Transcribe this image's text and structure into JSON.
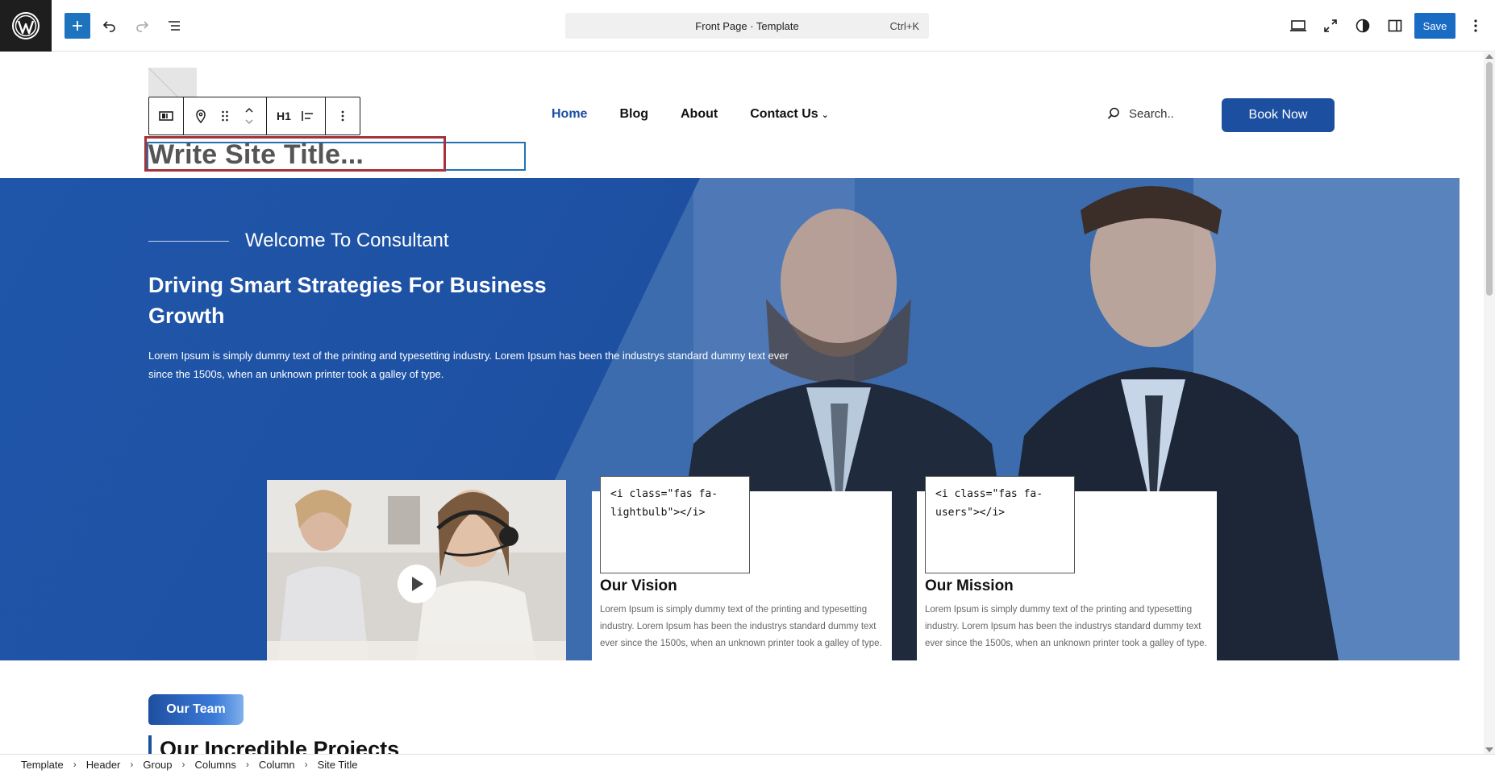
{
  "toolbar": {
    "document_title": "Front Page · Template",
    "shortcut": "Ctrl+K",
    "save_label": "Save"
  },
  "header": {
    "site_title_placeholder": "Write Site Title...",
    "block_toolbar": {
      "heading_level": "H1"
    },
    "nav": [
      {
        "label": "Home",
        "active": true
      },
      {
        "label": "Blog",
        "active": false
      },
      {
        "label": "About",
        "active": false
      },
      {
        "label": "Contact Us",
        "active": false,
        "has_submenu": true
      }
    ],
    "search_placeholder": "Search..",
    "book_button": "Book Now"
  },
  "hero": {
    "welcome": "Welcome To Consultant",
    "title": "Driving Smart Strategies For Business Growth",
    "text": "Lorem Ipsum is simply dummy text of the printing and typesetting industry. Lorem Ipsum has been the industrys standard dummy text ever since the 1500s, when an unknown printer took a galley of type.",
    "cards": [
      {
        "code": "<i class=\"fas fa-lightbulb\"></i>",
        "title": "Our Vision",
        "text": "Lorem Ipsum is simply dummy text of the printing and typesetting industry. Lorem Ipsum has been the industrys standard dummy text ever since the 1500s, when an unknown printer took a galley of type."
      },
      {
        "code": "<i class=\"fas fa-users\"></i>",
        "title": "Our Mission",
        "text": "Lorem Ipsum is simply dummy text of the printing and typesetting industry. Lorem Ipsum has been the industrys standard dummy text ever since the 1500s, when an unknown printer took a galley of type."
      }
    ]
  },
  "sections": {
    "team_pill": "Our Team",
    "projects_title": "Our Incredible Projects"
  },
  "breadcrumb": [
    "Template",
    "Header",
    "Group",
    "Columns",
    "Column",
    "Site Title"
  ],
  "colors": {
    "brand_blue": "#1d4fa0",
    "selection_outline": "#2271b1",
    "highlight_outline": "#a4343a"
  }
}
